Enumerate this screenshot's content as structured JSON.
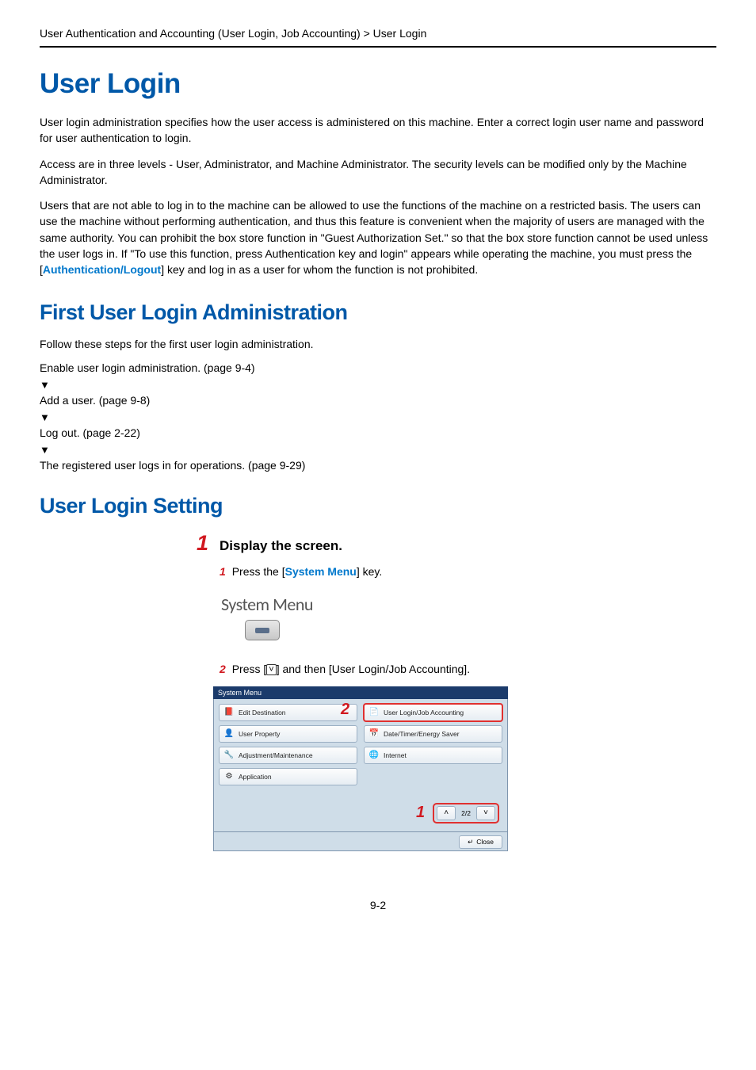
{
  "breadcrumb": "User Authentication and Accounting (User Login, Job Accounting) > User Login",
  "title": "User Login",
  "paragraphs": {
    "p1": "User login administration specifies how the user access is administered on this machine. Enter a correct login user name and password for user authentication to login.",
    "p2": "Access are in three levels - User, Administrator, and Machine Administrator. The security levels can be modified only by the Machine Administrator.",
    "p3a": "Users that are not able to log in to the machine can be allowed to use the functions of the machine on a restricted basis. The users can use the machine without performing authentication, and thus this feature is convenient when the majority of users are managed with the same authority. You can prohibit the box store function in \"Guest Authorization Set.\" so that the box store function cannot be used unless the user logs in. If \"To use this function, press Authentication key and login\" appears while operating the machine, you must press the [",
    "p3key": "Authentication/Logout",
    "p3b": "] key and log in as a user for whom the function is not prohibited."
  },
  "section_first": {
    "heading": "First User Login Administration",
    "intro": "Follow these steps for the first user login administration.",
    "steps": {
      "s1": "Enable user login administration. (page 9-4)",
      "s2": "Add a user. (page 9-8)",
      "s3": "Log out. (page 2-22)",
      "s4": "The registered user logs in for operations. (page 9-29)"
    }
  },
  "section_setting": {
    "heading": "User Login Setting",
    "step1": {
      "num": "1",
      "title": "Display the screen.",
      "sub1_num": "1",
      "sub1_a": "Press the [",
      "sub1_key": "System Menu",
      "sub1_b": "] key.",
      "graphic_label": "System Menu",
      "sub2_num": "2",
      "sub2_a": "Press [",
      "sub2_chev": "˅",
      "sub2_b": "] and then [User Login/Job Accounting]."
    }
  },
  "panel": {
    "titlebar": "System Menu",
    "left": [
      {
        "icon": "📕",
        "label": "Edit Destination"
      },
      {
        "icon": "👤",
        "label": "User Property"
      },
      {
        "icon": "🔧",
        "label": "Adjustment/Maintenance"
      },
      {
        "icon": "⚙",
        "label": "Application"
      }
    ],
    "right": [
      {
        "icon": "📄",
        "label": "User Login/Job Accounting",
        "highlight": true
      },
      {
        "icon": "📅",
        "label": "Date/Timer/Energy Saver"
      },
      {
        "icon": "🌐",
        "label": "Internet"
      }
    ],
    "callout_two": "2",
    "callout_one": "1",
    "pager": {
      "up": "˄",
      "text": "2/2",
      "down": "˅"
    },
    "close_label": "Close",
    "close_icon": "↵"
  },
  "footer_page": "9-2"
}
